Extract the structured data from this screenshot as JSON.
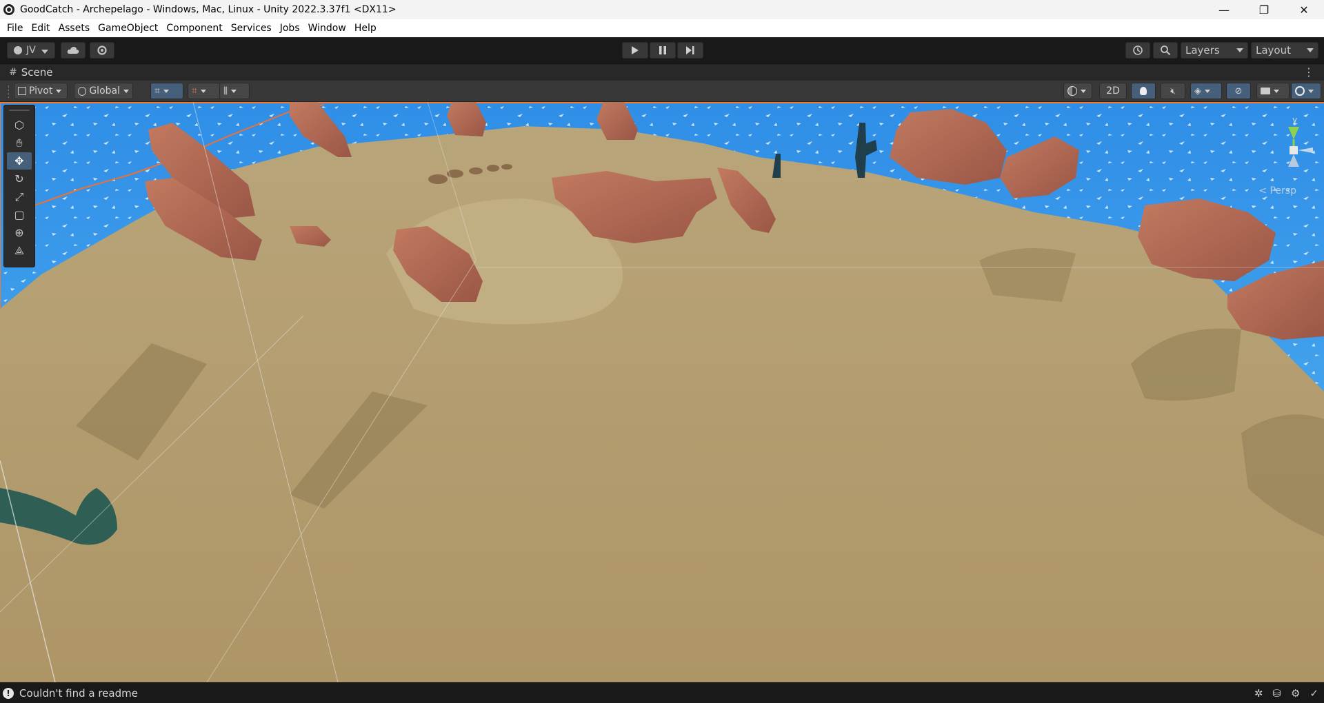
{
  "window": {
    "title": "GoodCatch - Archepelago - Windows, Mac, Linux - Unity 2022.3.37f1 <DX11>",
    "minimize": "—",
    "maximize": "❐",
    "close": "✕"
  },
  "menu": [
    "File",
    "Edit",
    "Assets",
    "GameObject",
    "Component",
    "Services",
    "Jobs",
    "Window",
    "Help"
  ],
  "toolbar": {
    "account": "JV",
    "play": "▶",
    "pause": "❚❚",
    "step": "▶|",
    "layers": "Layers",
    "layout": "Layout"
  },
  "scene": {
    "tab_label": "Scene",
    "pivot": "Pivot",
    "global": "Global",
    "mode_2d": "2D",
    "persp": "< Persp"
  },
  "gizmo": {
    "axis_y": "y"
  },
  "status": {
    "message": "Couldn't find a readme"
  },
  "colors": {
    "accent_active": "#46607c",
    "sand": "#b09a6c",
    "rock": "#b06a52",
    "water": "#3aa4ec"
  }
}
